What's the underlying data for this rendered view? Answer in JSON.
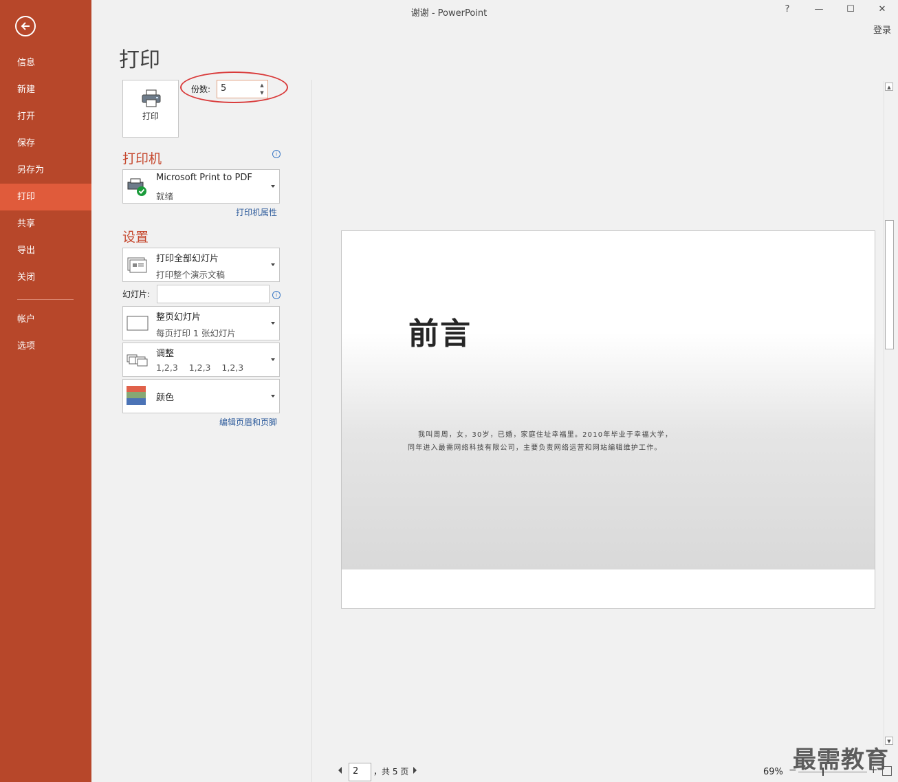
{
  "window": {
    "title": "谢谢 - PowerPoint",
    "help": "?",
    "minimize": "—",
    "maximize": "☐",
    "close": "✕",
    "login": "登录"
  },
  "sidebar": {
    "items": [
      {
        "label": "信息"
      },
      {
        "label": "新建"
      },
      {
        "label": "打开"
      },
      {
        "label": "保存"
      },
      {
        "label": "另存为"
      },
      {
        "label": "打印"
      },
      {
        "label": "共享"
      },
      {
        "label": "导出"
      },
      {
        "label": "关闭"
      },
      {
        "label": "帐户"
      },
      {
        "label": "选项"
      }
    ],
    "active": "打印"
  },
  "main": {
    "title": "打印",
    "print_button": "打印",
    "copies_label": "份数:",
    "copies_value": "5",
    "printer": {
      "section": "打印机",
      "name": "Microsoft Print to PDF",
      "status": "就绪",
      "properties_link": "打印机属性"
    },
    "settings": {
      "section": "设置",
      "range_main": "打印全部幻灯片",
      "range_sub": "打印整个演示文稿",
      "slides_label": "幻灯片:",
      "slides_value": "",
      "layout_main": "整页幻灯片",
      "layout_sub": "每页打印 1 张幻灯片",
      "collate_main": "调整",
      "collate_sub": "1,2,3    1,2,3    1,2,3",
      "color_main": "颜色",
      "header_footer_link": "编辑页眉和页脚"
    }
  },
  "preview": {
    "slide_title": "前言",
    "slide_line1": "我叫周周，女，30岁，已婚，家庭住址幸福里。2010年毕业于幸福大学，",
    "slide_line2": "同年进入最需网络科技有限公司，主要负责网络运营和网站编辑维护工作。",
    "page_current": "2",
    "page_total": "，共 5 页",
    "zoom": "69%",
    "zoom_minus": "−",
    "zoom_plus": "+"
  },
  "watermark": "最需教育",
  "colors": {
    "sidebar": "#b7472a",
    "sidebar_active": "#e05b3b",
    "accent_title": "#c5472d",
    "link": "#2e5c9c",
    "annotation": "#d93a3a"
  }
}
